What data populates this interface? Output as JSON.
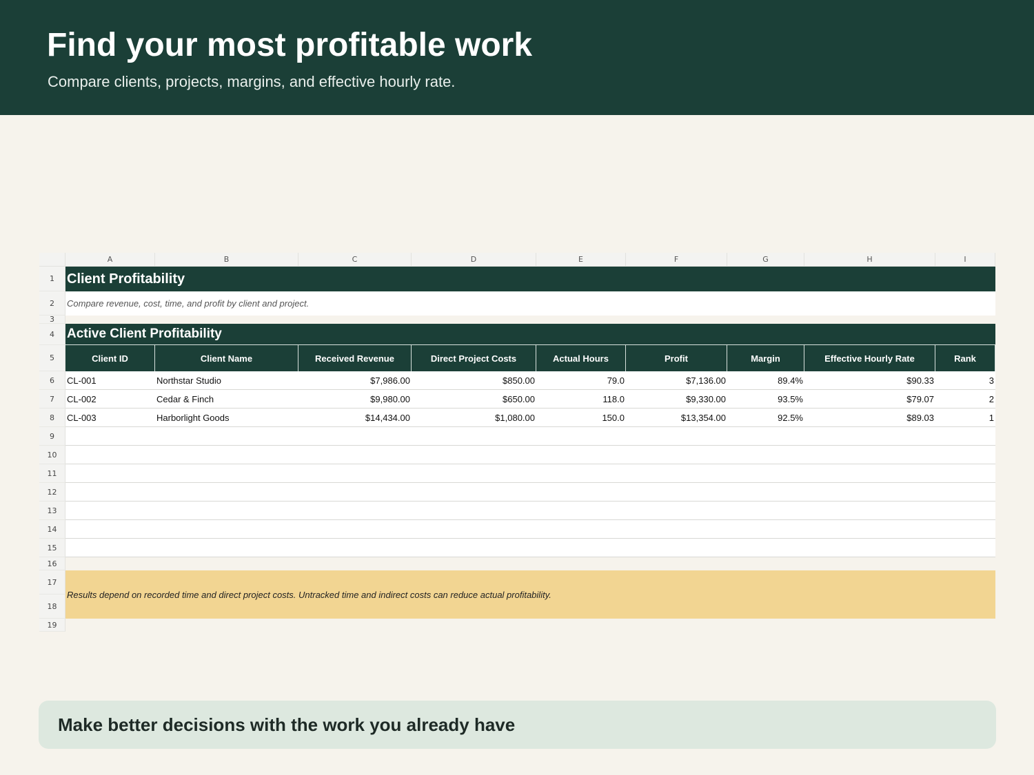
{
  "hero": {
    "title": "Find your most profitable work",
    "subtitle": "Compare clients, projects, margins, and effective hourly rate."
  },
  "sheet": {
    "columns": [
      "A",
      "B",
      "C",
      "D",
      "E",
      "F",
      "G",
      "H",
      "I"
    ],
    "row_numbers": [
      "1",
      "2",
      "3",
      "4",
      "5",
      "6",
      "7",
      "8",
      "9",
      "10",
      "11",
      "12",
      "13",
      "14",
      "15",
      "16",
      "17",
      "18",
      "19"
    ],
    "title": "Client Profitability",
    "subtitle": "Compare revenue, cost, time, and profit by client and project.",
    "section_title": "Active Client Profitability",
    "headers": [
      "Client ID",
      "Client Name",
      "Received Revenue",
      "Direct Project Costs",
      "Actual Hours",
      "Profit",
      "Margin",
      "Effective Hourly Rate",
      "Rank"
    ],
    "rows": [
      [
        "CL-001",
        "Northstar Studio",
        "$7,986.00",
        "$850.00",
        "79.0",
        "$7,136.00",
        "89.4%",
        "$90.33",
        "3"
      ],
      [
        "CL-002",
        "Cedar & Finch",
        "$9,980.00",
        "$650.00",
        "118.0",
        "$9,330.00",
        "93.5%",
        "$79.07",
        "2"
      ],
      [
        "CL-003",
        "Harborlight Goods",
        "$14,434.00",
        "$1,080.00",
        "150.0",
        "$13,354.00",
        "92.5%",
        "$89.03",
        "1"
      ]
    ],
    "disclaimer": "Results depend on recorded time and direct project costs. Untracked time and indirect costs can reduce actual profitability."
  },
  "footer": {
    "cta": "Make better decisions with the work you already have"
  },
  "colors": {
    "brand_dark": "#1b3f37",
    "background": "#f6f3ec",
    "note_yellow": "#f2d592",
    "card_green": "#dde8df"
  }
}
